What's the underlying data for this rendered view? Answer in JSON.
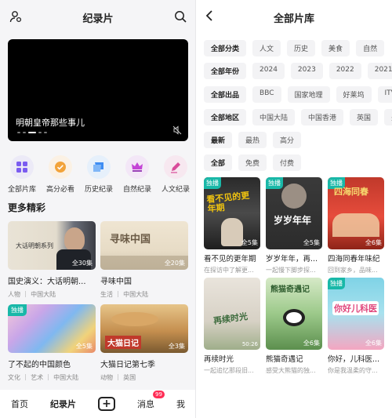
{
  "left": {
    "title": "纪录片",
    "player_caption": "明朝皇帝那些事儿",
    "categories": [
      {
        "label": "全部片库",
        "icon": "grid-icon"
      },
      {
        "label": "高分必看",
        "icon": "check-badge-icon"
      },
      {
        "label": "历史纪录",
        "icon": "scroll-icon"
      },
      {
        "label": "自然纪录",
        "icon": "crown-icon"
      },
      {
        "label": "人文纪录",
        "icon": "pen-icon"
      }
    ],
    "more_title": "更多精彩",
    "cards": [
      {
        "title": "国史演义：大话明朝...",
        "sub": "人物 ｜ 中国大陆",
        "eps": "全30集",
        "thumb_text": "大话明朝系列",
        "badge": ""
      },
      {
        "title": "寻味中国",
        "sub": "生活 ｜ 中国大陆",
        "eps": "全20集",
        "thumb_text": "寻味中国",
        "badge": ""
      },
      {
        "title": "了不起的中国颜色",
        "sub": "文化 ｜ 艺术 ｜ 中国大陆",
        "eps": "全5集",
        "thumb_text": "",
        "badge": "独播"
      },
      {
        "title": "大猫日记第七季",
        "sub": "动物 ｜ 英国",
        "eps": "全3集",
        "thumb_text": "大猫日记",
        "badge": ""
      }
    ],
    "tabbar": {
      "home": "首页",
      "docs": "纪录片",
      "plus": "+",
      "messages": "消息",
      "messages_badge": "99",
      "me": "我"
    }
  },
  "right": {
    "title": "全部片库",
    "filters": [
      {
        "head": "全部分类",
        "options": [
          "人文",
          "历史",
          "美食",
          "自然"
        ]
      },
      {
        "head": "全部年份",
        "options": [
          "2024",
          "2023",
          "2022",
          "2021"
        ]
      },
      {
        "head": "全部出品",
        "options": [
          "BBC",
          "国家地理",
          "好莱坞",
          "ITV"
        ]
      },
      {
        "head": "全部地区",
        "options": [
          "中国大陆",
          "中国香港",
          "英国",
          "美"
        ]
      },
      {
        "head": "最新",
        "options": [
          "最热",
          "高分"
        ]
      },
      {
        "head": "全部",
        "options": [
          "免费",
          "付费"
        ]
      }
    ],
    "posters": [
      {
        "title": "看不见的更年期",
        "sub": "在探访中了解更...",
        "eps": "全5集",
        "tag": "独播",
        "dur": "",
        "poster_text": "看不见的更年期"
      },
      {
        "title": "岁岁年年，再...",
        "sub": "一起慢下脚步探...",
        "eps": "全5集",
        "tag": "独播",
        "dur": "",
        "poster_text": "岁岁年年"
      },
      {
        "title": "四海同春年味纪",
        "sub": "回到家乡，品味...",
        "eps": "全6集",
        "tag": "独播",
        "dur": "",
        "poster_text": "四海同春"
      },
      {
        "title": "再续时光",
        "sub": "一起追忆那段旧...",
        "eps": "",
        "tag": "",
        "dur": "50:26",
        "poster_text": "再续时光"
      },
      {
        "title": "熊猫奇遇记",
        "sub": "感受大熊猫的独...",
        "eps": "全6集",
        "tag": "",
        "dur": "",
        "poster_text": "熊猫奇遇记"
      },
      {
        "title": "你好，儿科医...",
        "sub": "你是我温柔的守...",
        "eps": "全6集",
        "tag": "独播",
        "dur": "",
        "poster_text": "你好儿科医"
      }
    ]
  },
  "colors": {
    "accent_teal": "#19b8a8",
    "badge_red": "#ff2d55",
    "icon_purple": "#7b5cf0"
  }
}
